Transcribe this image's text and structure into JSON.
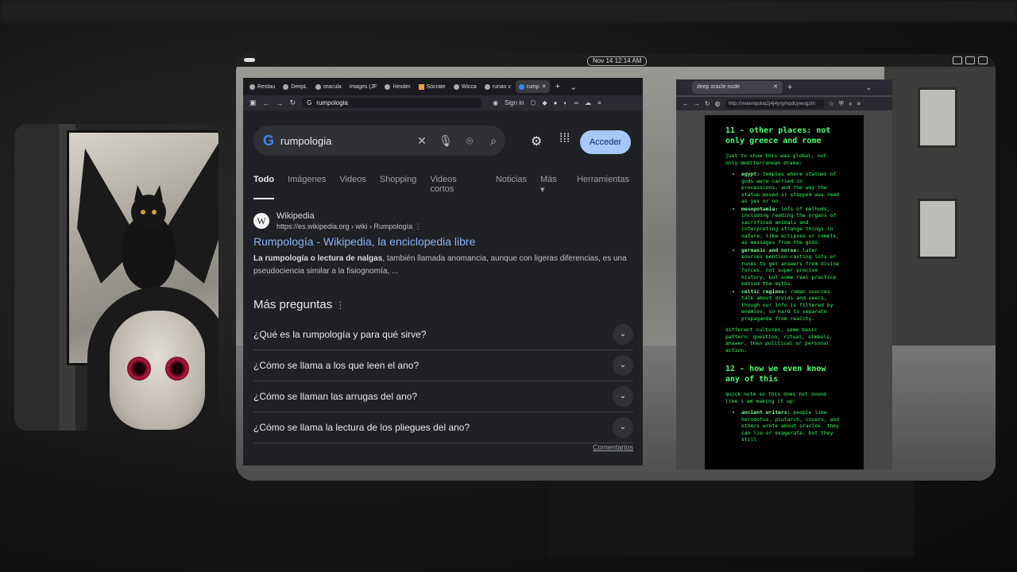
{
  "desktop": {
    "clock": "Nov 14  12:14 AM"
  },
  "browser1": {
    "tabs": [
      "Restau",
      "DeepL",
      "oracula",
      "images (JF",
      "Hexám",
      "Sócrate",
      "Wicca",
      "runas v",
      "rump"
    ],
    "url": "rumpologia",
    "signin": "Sign in"
  },
  "google": {
    "query": "rumpologia",
    "acceder": "Acceder",
    "tabs": [
      "Todo",
      "Imágenes",
      "Videos",
      "Shopping",
      "Videos cortos",
      "Noticias",
      "Más",
      "Herramientas"
    ],
    "result": {
      "site": "Wikipedia",
      "crumb": "https://es.wikipedia.org › wiki › Rumpología",
      "title": "Rumpología - Wikipedia, la enciclopedia libre",
      "snippet_bold": "La rumpología o lectura de nalgas",
      "snippet_rest": ", también llamada anomancia, aunque con ligeras diferencias, es una pseudociencia similar a la fisiognomía, ..."
    },
    "mas_preguntas": "Más preguntas",
    "questions": [
      "¿Qué es la rumpología y para qué sirve?",
      "¿Cómo se llama a los que leen el ano?",
      "¿Cómo se llaman las arrugas del ano?",
      "¿Cómo se llama la lectura de los pliegues del ano?"
    ],
    "comentarios": "Comentarios"
  },
  "browser2": {
    "tab": "deep oracle node",
    "url": "http://xwamqobq2j4j4yrjyhqdcywugzhi"
  },
  "terminal": {
    "h11": "11 - other places: not only greece and rome",
    "p11": "just to show this was global, not only mediterranean drama:",
    "items11": [
      {
        "k": "egypt:",
        "v": " temples where statues of gods were carried in processions, and the way the statue moved or stopped was read as yes or no."
      },
      {
        "k": "mesopotamia:",
        "v": " lots of methods, including reading the organs of sacrificed animals and interpreting strange things in nature, like eclipses or comets, as messages from the gods."
      },
      {
        "k": "germanic and norse:",
        "v": " later sources mention casting lots or runes to get answers from divine forces. not super precise history, but some real practice behind the myths."
      },
      {
        "k": "celtic regions:",
        "v": " roman sources talk about druids and seers, though our info is filtered by enemies, so hard to separate propaganda from reality."
      }
    ],
    "p11b": "different cultures, same basic pattern: question, ritual, simbols, answer, then political or personal action.",
    "h12": "12 - how we even know any of this",
    "p12": "quick note so this does not sound like i am making it up:",
    "items12": [
      {
        "k": "ancient writers:",
        "v": " people like herodotus, plutarch, cicero, and others wrote about oracles. they can lie or exagerate, but they still"
      }
    ]
  }
}
